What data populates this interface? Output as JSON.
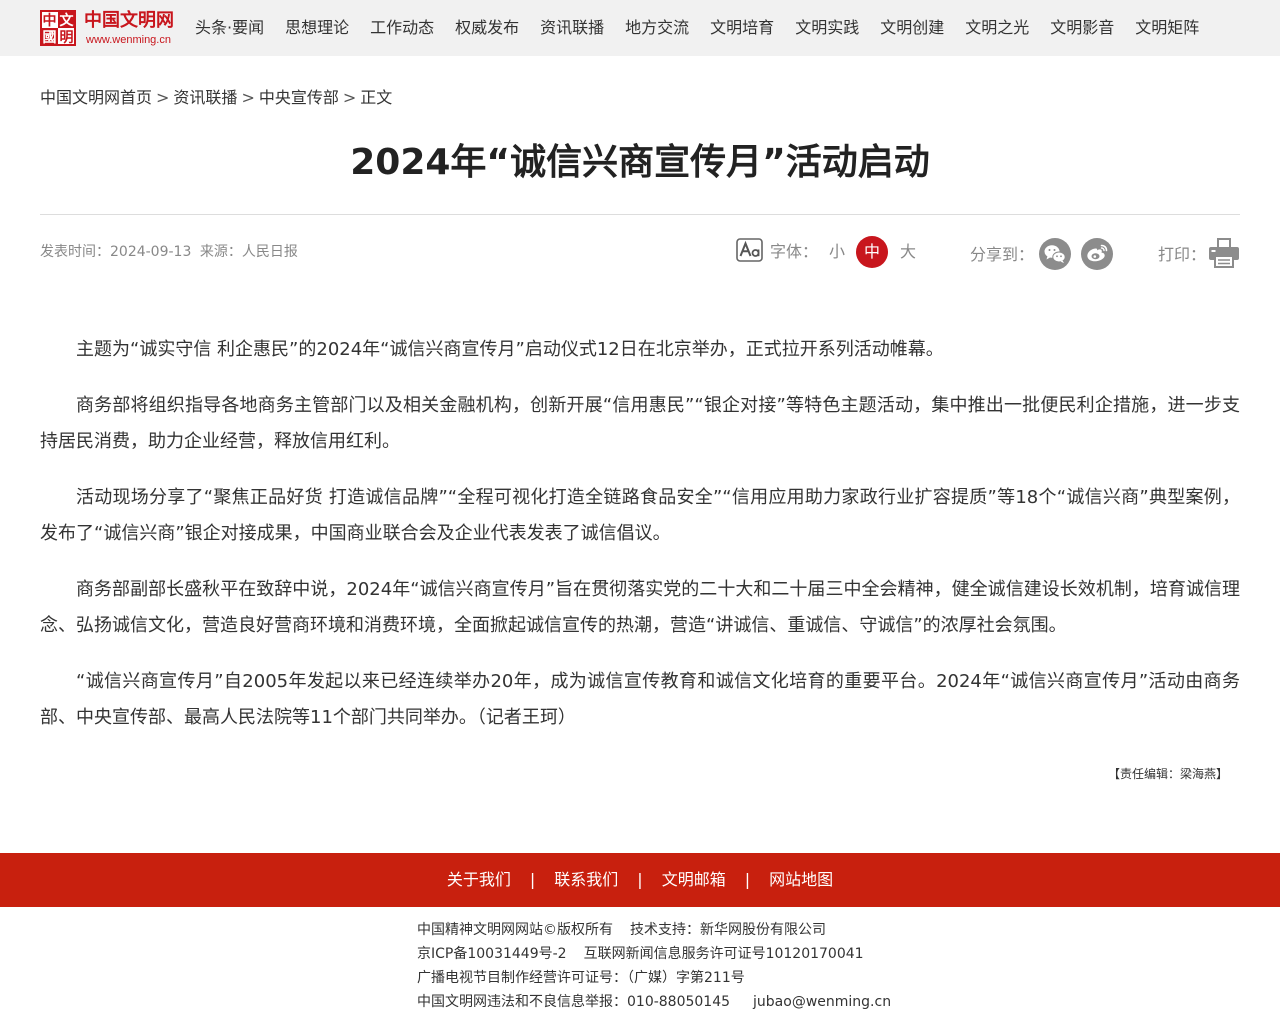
{
  "colors": {
    "brand": "#c8161d",
    "footer": "#c8200e",
    "text": "#333333",
    "muted": "#888888",
    "icon": "#8c8c8c",
    "header_bg": "#f1f1f1",
    "divider": "#dddddd"
  },
  "logo": {
    "seal": [
      "中",
      "文",
      "國",
      "明"
    ],
    "name": "中国文明网",
    "url": "www.wenming.cn"
  },
  "nav": [
    "头条·要闻",
    "思想理论",
    "工作动态",
    "权威发布",
    "资讯联播",
    "地方交流",
    "文明培育",
    "文明实践",
    "文明创建",
    "文明之光",
    "文明影音",
    "文明矩阵"
  ],
  "breadcrumb": {
    "items": [
      "中国文明网首页",
      "资讯联播",
      "中央宣传部",
      "正文"
    ],
    "separator": ">"
  },
  "article": {
    "title": "2024年“诚信兴商宣传月”活动启动",
    "meta": {
      "publish_label": "发表时间：",
      "date": "2024-09-13",
      "source_label": "来源：",
      "source": "人民日报"
    },
    "paragraphs": [
      "主题为“诚实守信 利企惠民”的2024年“诚信兴商宣传月”启动仪式12日在北京举办，正式拉开系列活动帷幕。",
      "商务部将组织指导各地商务主管部门以及相关金融机构，创新开展“信用惠民”“银企对接”等特色主题活动，集中推出一批便民利企措施，进一步支持居民消费，助力企业经营，释放信用红利。",
      "活动现场分享了“聚焦正品好货 打造诚信品牌”“全程可视化打造全链路食品安全”“信用应用助力家政行业扩容提质”等18个“诚信兴商”典型案例，发布了“诚信兴商”银企对接成果，中国商业联合会及企业代表发表了诚信倡议。",
      "商务部副部长盛秋平在致辞中说，2024年“诚信兴商宣传月”旨在贯彻落实党的二十大和二十届三中全会精神，健全诚信建设长效机制，培育诚信理念、弘扬诚信文化，营造良好营商环境和消费环境，全面掀起诚信宣传的热潮，营造“讲诚信、重诚信、守诚信”的浓厚社会氛围。",
      "“诚信兴商宣传月”自2005年发起以来已经连续举办20年，成为诚信宣传教育和诚信文化培育的重要平台。2024年“诚信兴商宣传月”活动由商务部、中央宣传部、最高人民法院等11个部门共同举办。（记者王珂）"
    ],
    "editor": "【责任编辑：梁海燕】"
  },
  "tools": {
    "font_icon": "font-size-icon",
    "font_label": "字体：",
    "font_small": "小",
    "font_medium": "中",
    "font_large": "大",
    "font_selected": "中",
    "share_label": "分享到：",
    "share_icons": [
      "wechat-icon",
      "weibo-icon"
    ],
    "print_label": "打印：",
    "print_icon": "printer-icon"
  },
  "footer": {
    "links": [
      "关于我们",
      "联系我们",
      "文明邮箱",
      "网站地图"
    ],
    "separator": "|",
    "lines": [
      [
        "中国精神文明网网站©版权所有",
        "技术支持：新华网股份有限公司"
      ],
      [
        "京ICP备10031449号-2",
        "互联网新闻信息服务许可证号10120170041"
      ],
      [
        "广播电视节目制作经营许可证号：（广媒）字第211号"
      ],
      [
        "中国文明网违法和不良信息举报：010-88050145",
        "jubao@wenming.cn"
      ]
    ]
  }
}
